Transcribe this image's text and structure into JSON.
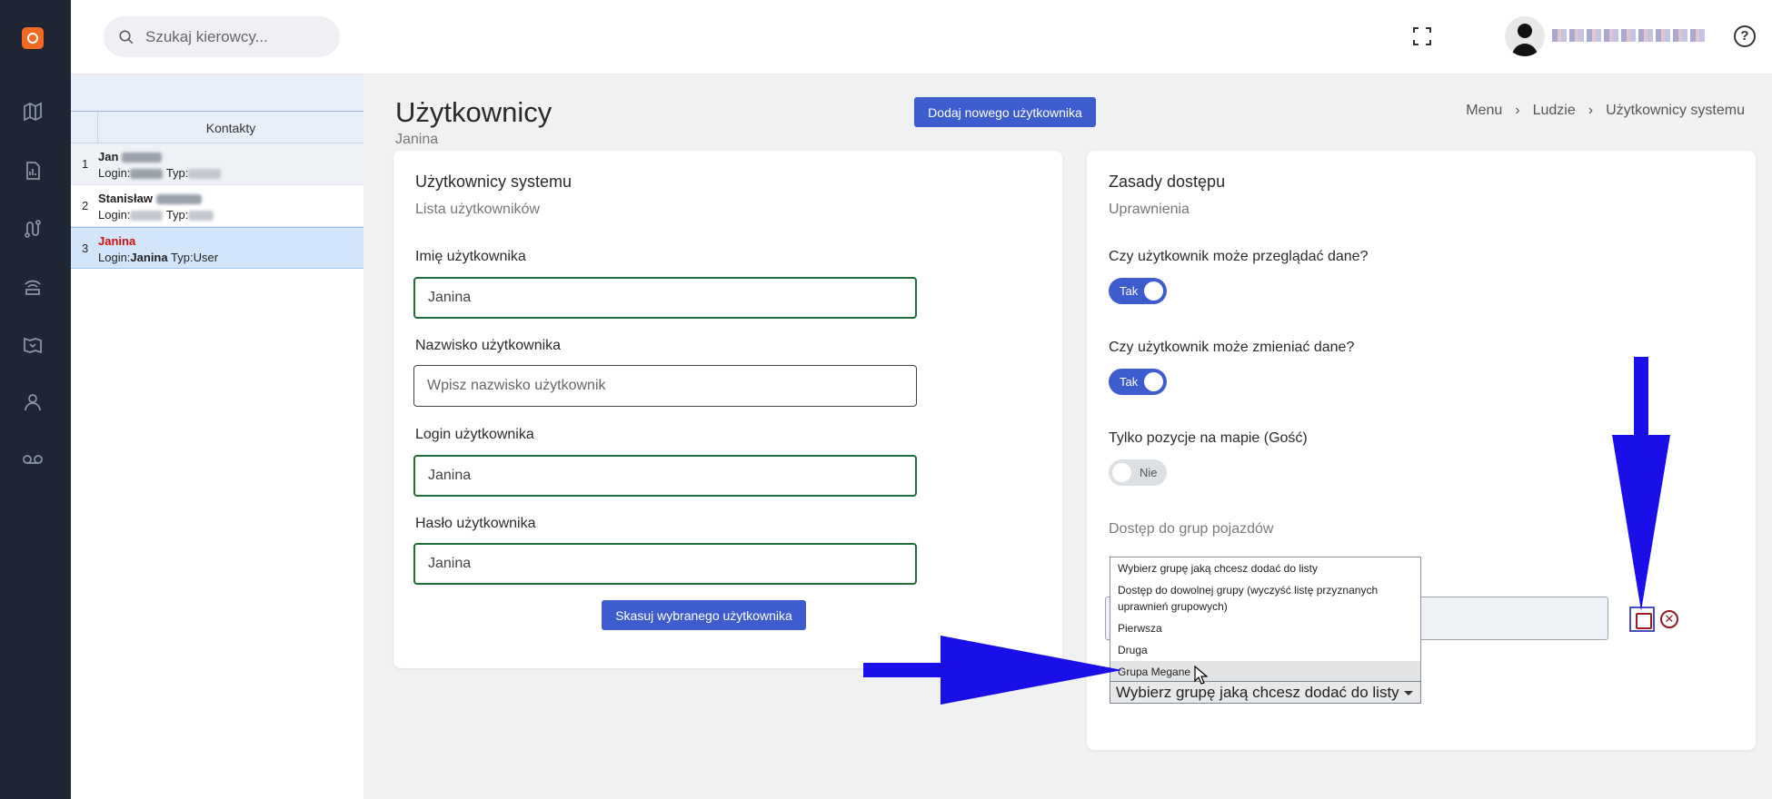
{
  "search": {
    "placeholder": "Szukaj kierowcy..."
  },
  "sidebar": {
    "icons": [
      "map-icon",
      "report-icon",
      "route-icon",
      "signal-icon",
      "map-alt-icon",
      "person-icon",
      "voicemail-icon"
    ]
  },
  "contacts": {
    "header": "Kontakty",
    "rows": [
      {
        "index": "1",
        "first_name": "Jan",
        "login_prefix": "Login:",
        "type_prefix": "Typ:"
      },
      {
        "index": "2",
        "first_name": "Stanisław",
        "login_prefix": "Login:",
        "type_prefix": "Typ:"
      },
      {
        "index": "3",
        "first_name": "Janina",
        "login_prefix": "Login:",
        "login": "Janina",
        "type_prefix": "Typ:",
        "type": "User"
      }
    ]
  },
  "page": {
    "title": "Użytkownicy",
    "subtitle": "Janina",
    "add_button": "Dodaj nowego użytkownika",
    "breadcrumb": [
      "Menu",
      "Ludzie",
      "Użytkownicy systemu"
    ]
  },
  "users_card": {
    "title": "Użytkownicy systemu",
    "subtitle": "Lista użytkowników",
    "first_name_label": "Imię użytkownika",
    "first_name_value": "Janina",
    "last_name_label": "Nazwisko użytkownika",
    "last_name_placeholder": "Wpisz nazwisko użytkownik",
    "login_label": "Login użytkownika",
    "login_value": "Janina",
    "password_label": "Hasło użytkownika",
    "password_value": "Janina",
    "delete_button": "Skasuj wybranego użytkownika"
  },
  "access_card": {
    "title": "Zasady dostępu",
    "subtitle": "Uprawnienia",
    "view_question": "Czy użytkownik może przeglądać dane?",
    "view_toggle": "Tak",
    "edit_question": "Czy użytkownik może zmieniać dane?",
    "edit_toggle": "Tak",
    "guest_question": "Tylko pozycje na mapie (Gość)",
    "guest_toggle": "Nie",
    "groups_title": "Dostęp do grup pojazdów"
  },
  "group_dropdown": {
    "selected": "Wybierz grupę jaką chcesz dodać do listy",
    "options": [
      "Wybierz grupę jaką chcesz dodać do listy",
      "Dostęp do dowolnej grupy (wyczyść listę przyznanych uprawnień grupowych)",
      "Pierwsza",
      "Druga",
      "Grupa Megane"
    ],
    "hovered_option": "Grupa Megane"
  },
  "colors": {
    "primary": "#3d5ccd",
    "sidebar_bg": "#1e2533",
    "input_border": "#1f6b3a",
    "selected_name": "#d10d0d",
    "annotation_arrow": "#1a0fe8"
  }
}
